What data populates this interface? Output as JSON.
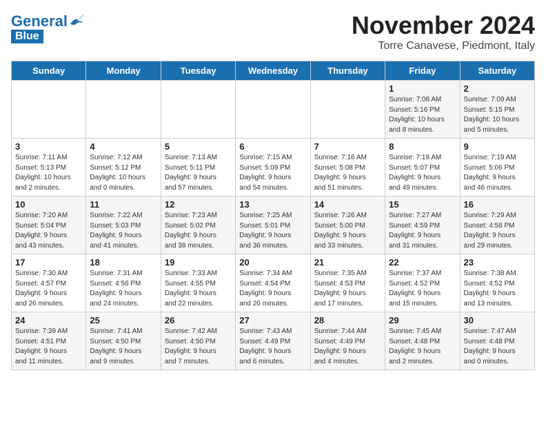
{
  "header": {
    "logo_general": "General",
    "logo_blue": "Blue",
    "month_title": "November 2024",
    "location": "Torre Canavese, Piedmont, Italy"
  },
  "weekdays": [
    "Sunday",
    "Monday",
    "Tuesday",
    "Wednesday",
    "Thursday",
    "Friday",
    "Saturday"
  ],
  "weeks": [
    [
      {
        "day": "",
        "info": ""
      },
      {
        "day": "",
        "info": ""
      },
      {
        "day": "",
        "info": ""
      },
      {
        "day": "",
        "info": ""
      },
      {
        "day": "",
        "info": ""
      },
      {
        "day": "1",
        "info": "Sunrise: 7:08 AM\nSunset: 5:16 PM\nDaylight: 10 hours\nand 8 minutes."
      },
      {
        "day": "2",
        "info": "Sunrise: 7:09 AM\nSunset: 5:15 PM\nDaylight: 10 hours\nand 5 minutes."
      }
    ],
    [
      {
        "day": "3",
        "info": "Sunrise: 7:11 AM\nSunset: 5:13 PM\nDaylight: 10 hours\nand 2 minutes."
      },
      {
        "day": "4",
        "info": "Sunrise: 7:12 AM\nSunset: 5:12 PM\nDaylight: 10 hours\nand 0 minutes."
      },
      {
        "day": "5",
        "info": "Sunrise: 7:13 AM\nSunset: 5:11 PM\nDaylight: 9 hours\nand 57 minutes."
      },
      {
        "day": "6",
        "info": "Sunrise: 7:15 AM\nSunset: 5:09 PM\nDaylight: 9 hours\nand 54 minutes."
      },
      {
        "day": "7",
        "info": "Sunrise: 7:16 AM\nSunset: 5:08 PM\nDaylight: 9 hours\nand 51 minutes."
      },
      {
        "day": "8",
        "info": "Sunrise: 7:18 AM\nSunset: 5:07 PM\nDaylight: 9 hours\nand 49 minutes."
      },
      {
        "day": "9",
        "info": "Sunrise: 7:19 AM\nSunset: 5:06 PM\nDaylight: 9 hours\nand 46 minutes."
      }
    ],
    [
      {
        "day": "10",
        "info": "Sunrise: 7:20 AM\nSunset: 5:04 PM\nDaylight: 9 hours\nand 43 minutes."
      },
      {
        "day": "11",
        "info": "Sunrise: 7:22 AM\nSunset: 5:03 PM\nDaylight: 9 hours\nand 41 minutes."
      },
      {
        "day": "12",
        "info": "Sunrise: 7:23 AM\nSunset: 5:02 PM\nDaylight: 9 hours\nand 38 minutes."
      },
      {
        "day": "13",
        "info": "Sunrise: 7:25 AM\nSunset: 5:01 PM\nDaylight: 9 hours\nand 36 minutes."
      },
      {
        "day": "14",
        "info": "Sunrise: 7:26 AM\nSunset: 5:00 PM\nDaylight: 9 hours\nand 33 minutes."
      },
      {
        "day": "15",
        "info": "Sunrise: 7:27 AM\nSunset: 4:59 PM\nDaylight: 9 hours\nand 31 minutes."
      },
      {
        "day": "16",
        "info": "Sunrise: 7:29 AM\nSunset: 4:58 PM\nDaylight: 9 hours\nand 29 minutes."
      }
    ],
    [
      {
        "day": "17",
        "info": "Sunrise: 7:30 AM\nSunset: 4:57 PM\nDaylight: 9 hours\nand 26 minutes."
      },
      {
        "day": "18",
        "info": "Sunrise: 7:31 AM\nSunset: 4:56 PM\nDaylight: 9 hours\nand 24 minutes."
      },
      {
        "day": "19",
        "info": "Sunrise: 7:33 AM\nSunset: 4:55 PM\nDaylight: 9 hours\nand 22 minutes."
      },
      {
        "day": "20",
        "info": "Sunrise: 7:34 AM\nSunset: 4:54 PM\nDaylight: 9 hours\nand 20 minutes."
      },
      {
        "day": "21",
        "info": "Sunrise: 7:35 AM\nSunset: 4:53 PM\nDaylight: 9 hours\nand 17 minutes."
      },
      {
        "day": "22",
        "info": "Sunrise: 7:37 AM\nSunset: 4:52 PM\nDaylight: 9 hours\nand 15 minutes."
      },
      {
        "day": "23",
        "info": "Sunrise: 7:38 AM\nSunset: 4:52 PM\nDaylight: 9 hours\nand 13 minutes."
      }
    ],
    [
      {
        "day": "24",
        "info": "Sunrise: 7:39 AM\nSunset: 4:51 PM\nDaylight: 9 hours\nand 11 minutes."
      },
      {
        "day": "25",
        "info": "Sunrise: 7:41 AM\nSunset: 4:50 PM\nDaylight: 9 hours\nand 9 minutes."
      },
      {
        "day": "26",
        "info": "Sunrise: 7:42 AM\nSunset: 4:50 PM\nDaylight: 9 hours\nand 7 minutes."
      },
      {
        "day": "27",
        "info": "Sunrise: 7:43 AM\nSunset: 4:49 PM\nDaylight: 9 hours\nand 6 minutes."
      },
      {
        "day": "28",
        "info": "Sunrise: 7:44 AM\nSunset: 4:49 PM\nDaylight: 9 hours\nand 4 minutes."
      },
      {
        "day": "29",
        "info": "Sunrise: 7:45 AM\nSunset: 4:48 PM\nDaylight: 9 hours\nand 2 minutes."
      },
      {
        "day": "30",
        "info": "Sunrise: 7:47 AM\nSunset: 4:48 PM\nDaylight: 9 hours\nand 0 minutes."
      }
    ]
  ]
}
